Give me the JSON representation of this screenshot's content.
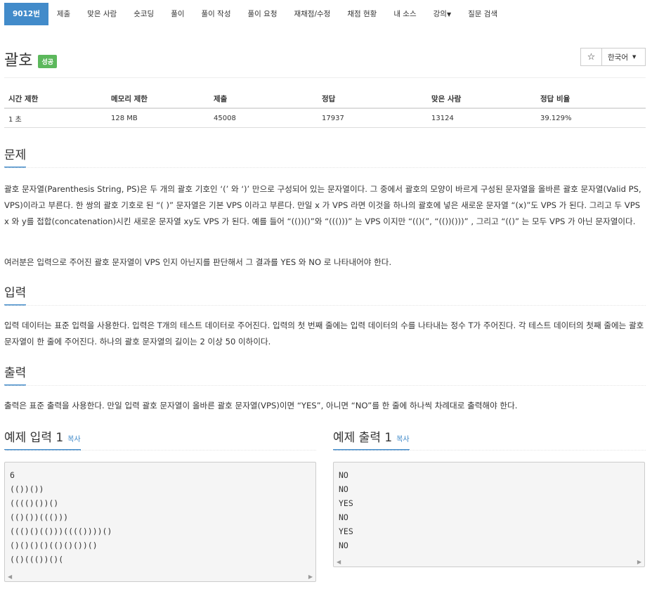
{
  "nav": {
    "items": [
      {
        "label": "9012번",
        "active": true
      },
      {
        "label": "제출"
      },
      {
        "label": "맞은 사람"
      },
      {
        "label": "숏코딩"
      },
      {
        "label": "풀이"
      },
      {
        "label": "풀이 작성"
      },
      {
        "label": "풀이 요청"
      },
      {
        "label": "재채점/수정"
      },
      {
        "label": "채점 현황"
      },
      {
        "label": "내 소스"
      },
      {
        "label": "강의",
        "dropdown": true
      },
      {
        "label": "질문 검색"
      }
    ]
  },
  "problem": {
    "title": "괄호",
    "status_badge": "성공",
    "star_icon": "☆",
    "language": "한국어"
  },
  "stats": {
    "headers": [
      "시간 제한",
      "메모리 제한",
      "제출",
      "정답",
      "맞은 사람",
      "정답 비율"
    ],
    "values": [
      "1 초",
      "128 MB",
      "45008",
      "17937",
      "13124",
      "39.129%"
    ]
  },
  "sections": {
    "description": {
      "heading": "문제",
      "paragraphs": [
        "괄호 문자열(Parenthesis String, PS)은 두 개의 괄호 기호인 ‘(’ 와 ‘)’ 만으로 구성되어 있는 문자열이다. 그 중에서 괄호의 모양이 바르게 구성된 문자열을 올바른 괄호 문자열(Valid PS, VPS)이라고 부른다. 한 쌍의 괄호 기호로 된 “( )” 문자열은 기본 VPS 이라고 부른다. 만일 x 가 VPS 라면 이것을 하나의 괄호에 넣은 새로운 문자열 “(x)”도 VPS 가 된다. 그리고 두 VPS x 와 y를 접합(concatenation)시킨 새로운 문자열 xy도 VPS 가 된다. 예를 들어 “(())()”와 “((()))” 는 VPS 이지만 “(()(”, “(())()))” , 그리고 “(()” 는 모두 VPS 가 아닌 문자열이다.",
        "여러분은 입력으로 주어진 괄호 문자열이 VPS 인지 아닌지를 판단해서 그 결과를 YES 와 NO 로 나타내어야 한다."
      ]
    },
    "input": {
      "heading": "입력",
      "text": "입력 데이터는 표준 입력을 사용한다. 입력은 T개의 테스트 데이터로 주어진다. 입력의 첫 번째 줄에는 입력 데이터의 수를 나타내는 정수 T가 주어진다. 각 테스트 데이터의 첫째 줄에는 괄호 문자열이 한 줄에 주어진다. 하나의 괄호 문자열의 길이는 2 이상 50 이하이다."
    },
    "output": {
      "heading": "출력",
      "text": "출력은 표준 출력을 사용한다. 만일 입력 괄호 문자열이 올바른 괄호 문자열(VPS)이면 “YES”, 아니면 “NO”를 한 줄에 하나씩 차례대로 출력해야 한다."
    }
  },
  "samples": {
    "copy_label": "복사",
    "input": {
      "heading": "예제 입력 1",
      "content": "6\n(())())\n(((()())()\n(()())((()))\n((()()(()))(((())))()\n()()()()(()()())()\n(()((())()("
    },
    "output": {
      "heading": "예제 출력 1",
      "content": "NO\nNO\nYES\nNO\nYES\nNO"
    }
  },
  "colors": {
    "accent": "#428bca",
    "success": "#5cb85c"
  }
}
